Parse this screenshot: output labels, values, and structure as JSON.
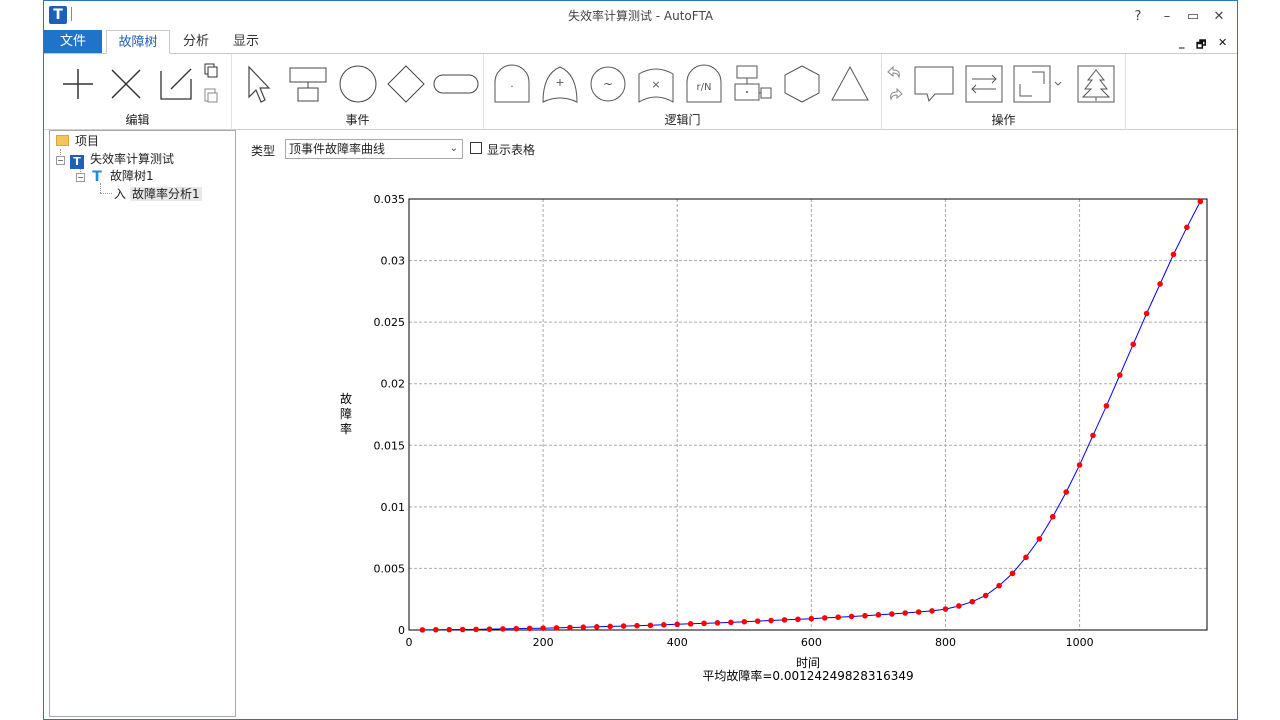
{
  "window": {
    "title": "失效率计算测试 - AutoFTA",
    "controls": {
      "help": "?",
      "minimize": "–",
      "maximize": "▭",
      "close": "✕"
    },
    "mdi_controls": {
      "minimize": "_",
      "restore": "🗗",
      "close": "✕"
    }
  },
  "tabs": [
    {
      "label": "文件"
    },
    {
      "label": "故障树"
    },
    {
      "label": "分析"
    },
    {
      "label": "显示"
    }
  ],
  "ribbon": {
    "groups": [
      {
        "label": "编辑"
      },
      {
        "label": "事件"
      },
      {
        "label": "逻辑门"
      },
      {
        "label": "操作"
      }
    ],
    "gate_labels": {
      "and": "·",
      "or": "+",
      "xor": "~",
      "inhibit": "×",
      "vote": "r/N"
    }
  },
  "tree": {
    "items": [
      {
        "label": "项目"
      },
      {
        "label": "失效率计算测试",
        "icon": "T"
      },
      {
        "label": "故障树1",
        "icon": "T"
      },
      {
        "label": "故障率分析1",
        "icon": "入"
      }
    ]
  },
  "toolbar": {
    "type_label": "类型",
    "type_value": "顶事件故障率曲线",
    "grid_label": "显示表格",
    "grid_checked": false
  },
  "chart_data": {
    "type": "line",
    "x_label": "时间",
    "y_label": "故障率",
    "subtitle": "平均故障率=0.00124249828316349",
    "xlim": [
      0,
      1190
    ],
    "ylim": [
      0,
      0.035
    ],
    "x_ticks": [
      0,
      200,
      400,
      600,
      800,
      1000
    ],
    "y_ticks": [
      0,
      0.005,
      0.01,
      0.015,
      0.02,
      0.025,
      0.03,
      0.035
    ],
    "x_tick_labels": [
      "0",
      "200",
      "400",
      "600",
      "800",
      "1000"
    ],
    "y_tick_labels": [
      "0",
      "0.005",
      "0.01",
      "0.015",
      "0.02",
      "0.025",
      "0.03",
      "0.035"
    ],
    "grid": true,
    "line_color": "#0000ff",
    "marker_color": "#ff0000",
    "x": [
      20,
      40,
      60,
      80,
      100,
      120,
      140,
      160,
      180,
      200,
      220,
      240,
      260,
      280,
      300,
      320,
      340,
      360,
      380,
      400,
      420,
      440,
      460,
      480,
      500,
      520,
      540,
      560,
      580,
      600,
      620,
      640,
      660,
      680,
      700,
      720,
      740,
      760,
      780,
      800,
      820,
      840,
      860,
      880,
      900,
      920,
      940,
      960,
      980,
      1000,
      1020,
      1040,
      1060,
      1080,
      1100,
      1120,
      1140,
      1160,
      1180
    ],
    "y": [
      1e-05,
      2e-05,
      3e-05,
      4e-05,
      5e-05,
      7e-05,
      9e-05,
      0.00011,
      0.00013,
      0.00015,
      0.00017,
      0.0002,
      0.00023,
      0.00026,
      0.00029,
      0.00032,
      0.00035,
      0.00038,
      0.00042,
      0.00046,
      0.0005,
      0.00054,
      0.00058,
      0.00062,
      0.00067,
      0.00072,
      0.00077,
      0.00082,
      0.00087,
      0.00092,
      0.00098,
      0.00104,
      0.0011,
      0.00116,
      0.00123,
      0.0013,
      0.00138,
      0.00146,
      0.00155,
      0.0017,
      0.00195,
      0.0023,
      0.0028,
      0.0036,
      0.0046,
      0.0059,
      0.0074,
      0.0092,
      0.0112,
      0.0134,
      0.0158,
      0.0182,
      0.0207,
      0.0232,
      0.0257,
      0.0281,
      0.0305,
      0.0327,
      0.0348
    ]
  }
}
